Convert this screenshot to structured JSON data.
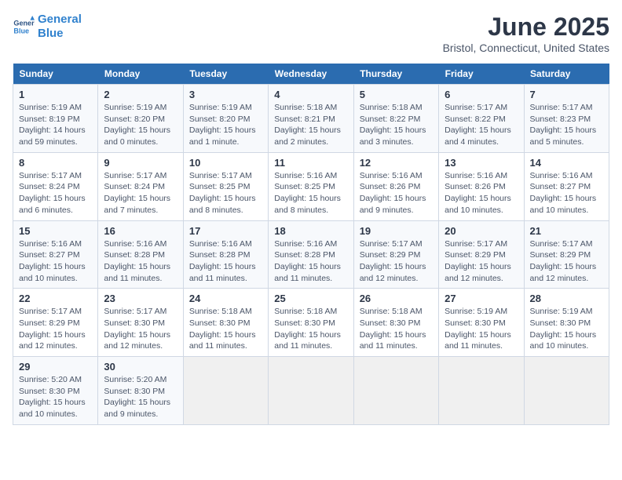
{
  "header": {
    "logo_line1": "General",
    "logo_line2": "Blue",
    "title": "June 2025",
    "subtitle": "Bristol, Connecticut, United States"
  },
  "calendar": {
    "day_headers": [
      "Sunday",
      "Monday",
      "Tuesday",
      "Wednesday",
      "Thursday",
      "Friday",
      "Saturday"
    ],
    "weeks": [
      [
        {
          "num": "",
          "empty": true
        },
        {
          "num": "2",
          "sunrise": "5:19 AM",
          "sunset": "8:20 PM",
          "daylight": "15 hours and 0 minutes."
        },
        {
          "num": "3",
          "sunrise": "5:19 AM",
          "sunset": "8:20 PM",
          "daylight": "15 hours and 1 minute."
        },
        {
          "num": "4",
          "sunrise": "5:18 AM",
          "sunset": "8:21 PM",
          "daylight": "15 hours and 2 minutes."
        },
        {
          "num": "5",
          "sunrise": "5:18 AM",
          "sunset": "8:22 PM",
          "daylight": "15 hours and 3 minutes."
        },
        {
          "num": "6",
          "sunrise": "5:17 AM",
          "sunset": "8:22 PM",
          "daylight": "15 hours and 4 minutes."
        },
        {
          "num": "7",
          "sunrise": "5:17 AM",
          "sunset": "8:23 PM",
          "daylight": "15 hours and 5 minutes."
        }
      ],
      [
        {
          "num": "1",
          "sunrise": "5:19 AM",
          "sunset": "8:19 PM",
          "daylight": "14 hours and 59 minutes."
        },
        {
          "num": "9",
          "sunrise": "5:17 AM",
          "sunset": "8:24 PM",
          "daylight": "15 hours and 7 minutes."
        },
        {
          "num": "10",
          "sunrise": "5:17 AM",
          "sunset": "8:25 PM",
          "daylight": "15 hours and 8 minutes."
        },
        {
          "num": "11",
          "sunrise": "5:16 AM",
          "sunset": "8:25 PM",
          "daylight": "15 hours and 8 minutes."
        },
        {
          "num": "12",
          "sunrise": "5:16 AM",
          "sunset": "8:26 PM",
          "daylight": "15 hours and 9 minutes."
        },
        {
          "num": "13",
          "sunrise": "5:16 AM",
          "sunset": "8:26 PM",
          "daylight": "15 hours and 10 minutes."
        },
        {
          "num": "14",
          "sunrise": "5:16 AM",
          "sunset": "8:27 PM",
          "daylight": "15 hours and 10 minutes."
        }
      ],
      [
        {
          "num": "8",
          "sunrise": "5:17 AM",
          "sunset": "8:24 PM",
          "daylight": "15 hours and 6 minutes."
        },
        {
          "num": "16",
          "sunrise": "5:16 AM",
          "sunset": "8:28 PM",
          "daylight": "15 hours and 11 minutes."
        },
        {
          "num": "17",
          "sunrise": "5:16 AM",
          "sunset": "8:28 PM",
          "daylight": "15 hours and 11 minutes."
        },
        {
          "num": "18",
          "sunrise": "5:16 AM",
          "sunset": "8:28 PM",
          "daylight": "15 hours and 11 minutes."
        },
        {
          "num": "19",
          "sunrise": "5:17 AM",
          "sunset": "8:29 PM",
          "daylight": "15 hours and 12 minutes."
        },
        {
          "num": "20",
          "sunrise": "5:17 AM",
          "sunset": "8:29 PM",
          "daylight": "15 hours and 12 minutes."
        },
        {
          "num": "21",
          "sunrise": "5:17 AM",
          "sunset": "8:29 PM",
          "daylight": "15 hours and 12 minutes."
        }
      ],
      [
        {
          "num": "15",
          "sunrise": "5:16 AM",
          "sunset": "8:27 PM",
          "daylight": "15 hours and 10 minutes."
        },
        {
          "num": "23",
          "sunrise": "5:17 AM",
          "sunset": "8:30 PM",
          "daylight": "15 hours and 12 minutes."
        },
        {
          "num": "24",
          "sunrise": "5:18 AM",
          "sunset": "8:30 PM",
          "daylight": "15 hours and 11 minutes."
        },
        {
          "num": "25",
          "sunrise": "5:18 AM",
          "sunset": "8:30 PM",
          "daylight": "15 hours and 11 minutes."
        },
        {
          "num": "26",
          "sunrise": "5:18 AM",
          "sunset": "8:30 PM",
          "daylight": "15 hours and 11 minutes."
        },
        {
          "num": "27",
          "sunrise": "5:19 AM",
          "sunset": "8:30 PM",
          "daylight": "15 hours and 11 minutes."
        },
        {
          "num": "28",
          "sunrise": "5:19 AM",
          "sunset": "8:30 PM",
          "daylight": "15 hours and 10 minutes."
        }
      ],
      [
        {
          "num": "22",
          "sunrise": "5:17 AM",
          "sunset": "8:29 PM",
          "daylight": "15 hours and 12 minutes."
        },
        {
          "num": "30",
          "sunrise": "5:20 AM",
          "sunset": "8:30 PM",
          "daylight": "15 hours and 9 minutes."
        },
        {
          "num": "",
          "empty": true
        },
        {
          "num": "",
          "empty": true
        },
        {
          "num": "",
          "empty": true
        },
        {
          "num": "",
          "empty": true
        },
        {
          "num": "",
          "empty": true
        }
      ],
      [
        {
          "num": "29",
          "sunrise": "5:20 AM",
          "sunset": "8:30 PM",
          "daylight": "15 hours and 10 minutes."
        },
        {
          "num": "",
          "empty": true
        },
        {
          "num": "",
          "empty": true
        },
        {
          "num": "",
          "empty": true
        },
        {
          "num": "",
          "empty": true
        },
        {
          "num": "",
          "empty": true
        },
        {
          "num": "",
          "empty": true
        }
      ]
    ]
  },
  "labels": {
    "sunrise": "Sunrise:",
    "sunset": "Sunset:",
    "daylight": "Daylight:"
  }
}
